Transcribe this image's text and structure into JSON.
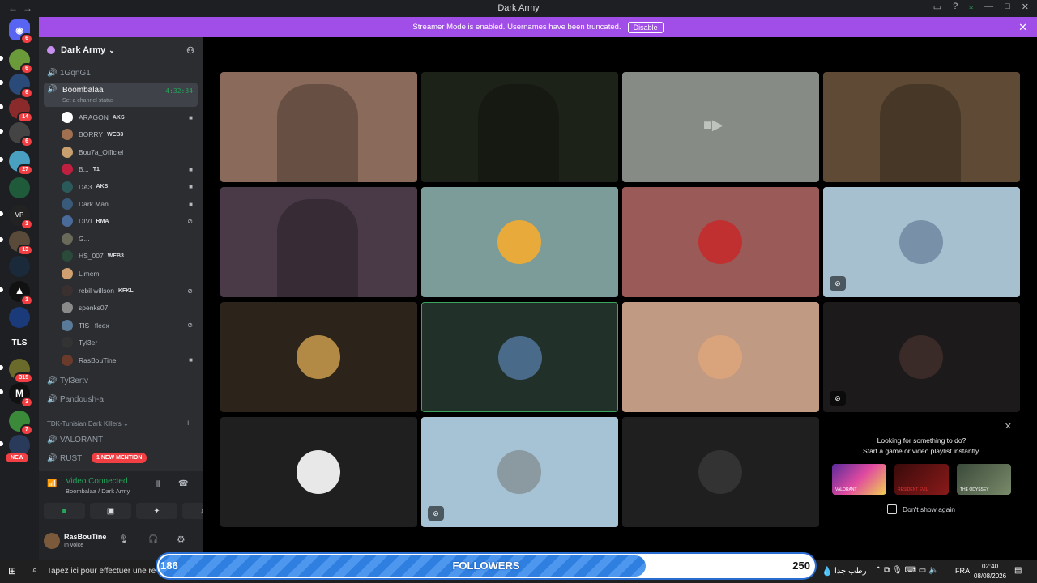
{
  "window": {
    "title": "Dark Army"
  },
  "banner": {
    "text": "Streamer Mode is enabled. Usernames have been truncated.",
    "button": "Disable"
  },
  "rail": {
    "badges": [
      "6",
      "6",
      "6",
      "14",
      "6",
      "27",
      "1",
      "13",
      "1",
      "TLS",
      "315",
      "3",
      "7",
      "NEW"
    ]
  },
  "server": {
    "name": "Dark Army"
  },
  "channels": {
    "top": "1GqnG1",
    "active": {
      "name": "Boombalaa",
      "timer": "4:32:34",
      "status": "Set a channel status"
    },
    "members": [
      {
        "name": "ARAGON",
        "tag": "AKS",
        "icon": "camera-icon"
      },
      {
        "name": "BORRY",
        "tag": "WEB3",
        "icon": ""
      },
      {
        "name": "Bou7a_Officiel",
        "tag": "",
        "icon": ""
      },
      {
        "name": "B...",
        "tag": "T1",
        "icon": "camera-icon"
      },
      {
        "name": "DA3",
        "tag": "AKS",
        "icon": "camera-icon"
      },
      {
        "name": "Dark Man",
        "tag": "",
        "icon": "camera-icon"
      },
      {
        "name": "DIVI",
        "tag": "RMA",
        "icon": "mute-icon"
      },
      {
        "name": "G...",
        "tag": "",
        "icon": ""
      },
      {
        "name": "HS_007",
        "tag": "WEB3",
        "icon": ""
      },
      {
        "name": "Limem",
        "tag": "",
        "icon": ""
      },
      {
        "name": "rebil willson",
        "tag": "KFKL",
        "icon": "mute-icon"
      },
      {
        "name": "spenks07",
        "tag": "",
        "icon": ""
      },
      {
        "name": "TIS l fleex",
        "tag": "",
        "icon": "mute-icon"
      },
      {
        "name": "Tyl3er",
        "tag": "",
        "icon": ""
      },
      {
        "name": "RasBouTine",
        "tag": "",
        "icon": "camera-icon"
      }
    ],
    "more": [
      "Tyl3ertv",
      "Pandoush-a"
    ],
    "category": "TDK-Tunisian Dark Killers",
    "cat_channels": [
      "VALORANT",
      "RUST"
    ],
    "mention": "1 NEW MENTION"
  },
  "voice": {
    "status": "Video Connected",
    "location": "Boombalaa / Dark Army"
  },
  "user": {
    "name": "RasBouTine",
    "status": "In voice"
  },
  "activity": {
    "line1": "Looking for something to do?",
    "line2": "Start a game or video playlist instantly.",
    "checkbox": "Don't show again",
    "games": [
      "VALORANT",
      "RESIDENT EVIL",
      "THE ODYSSEY"
    ]
  },
  "followers": {
    "label": "FOLLOWERS",
    "current": "186",
    "goal": "250",
    "progress": 0.744
  },
  "taskbar": {
    "search": "Tapez ici pour effectuer une re",
    "weather": "رطب جدا",
    "lang": "FRA",
    "time": "02:40",
    "date": "08/08/2026"
  },
  "tiles": [
    {
      "kind": "video",
      "color": "#8a6a5a"
    },
    {
      "kind": "video",
      "color": "#1d2219"
    },
    {
      "kind": "camoff",
      "color": "#868b85"
    },
    {
      "kind": "video",
      "color": "#5e4a35"
    },
    {
      "kind": "video",
      "color": "#4a3a48"
    },
    {
      "kind": "avatar",
      "color": "#7c9c99",
      "av": "#e8aa3a"
    },
    {
      "kind": "avatar",
      "color": "#9a5a58",
      "av": "#c03030"
    },
    {
      "kind": "avatar",
      "color": "#a6c0d0",
      "av": "#7890a8",
      "muted": true
    },
    {
      "kind": "avatar",
      "color": "#2c231a",
      "av": "#b28a45"
    },
    {
      "kind": "avatar",
      "color": "#213029",
      "av": "#4a6a8a",
      "active": true
    },
    {
      "kind": "avatar",
      "color": "#c19a83",
      "av": "#d9a47c"
    },
    {
      "kind": "avatar",
      "color": "#1c1a1b",
      "av": "#3a2a28",
      "muted": true
    },
    {
      "kind": "avatar",
      "color": "#1f1f1f",
      "av": "#e8e8e8"
    },
    {
      "kind": "avatar",
      "color": "#a6c3d6",
      "av": "#8a9aa0",
      "muted": true
    },
    {
      "kind": "avatar",
      "color": "#1f1f1f",
      "av": "#333"
    }
  ]
}
